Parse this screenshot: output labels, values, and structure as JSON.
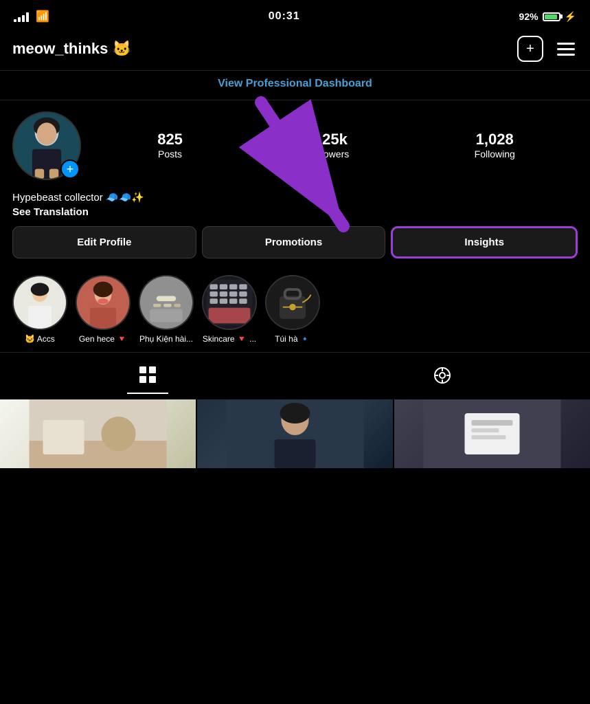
{
  "statusBar": {
    "time": "00:31",
    "battery": "92%",
    "batteryCharging": true
  },
  "header": {
    "username": "meow_thinks 🐱",
    "addButtonLabel": "+",
    "menuLabel": "☰"
  },
  "proDashboard": {
    "linkText": "View Professional Dashboard"
  },
  "profile": {
    "stats": [
      {
        "number": "825",
        "label": "Posts"
      },
      {
        "number": "3,25k",
        "label": "Followers"
      },
      {
        "number": "1,028",
        "label": "Following"
      }
    ],
    "bio": "Hypebeast collector 🧢🧢✨",
    "seeTranslation": "See Translation"
  },
  "actionButtons": [
    {
      "id": "edit-profile",
      "label": "Edit Profile"
    },
    {
      "id": "promotions",
      "label": "Promotions"
    },
    {
      "id": "insights",
      "label": "Insights"
    }
  ],
  "stories": [
    {
      "label": "🐱 Accs"
    },
    {
      "label": "Gen hece 🔻"
    },
    {
      "label": "Phụ Kiện hài..."
    },
    {
      "label": "Skincare 🔻 ..."
    },
    {
      "label": "Túi hà 🔹"
    }
  ],
  "bottomNav": [
    {
      "id": "grid",
      "icon": "⊞",
      "active": true
    },
    {
      "id": "tagged",
      "icon": "◎",
      "active": false
    }
  ],
  "annotation": {
    "arrowText": "↓"
  }
}
